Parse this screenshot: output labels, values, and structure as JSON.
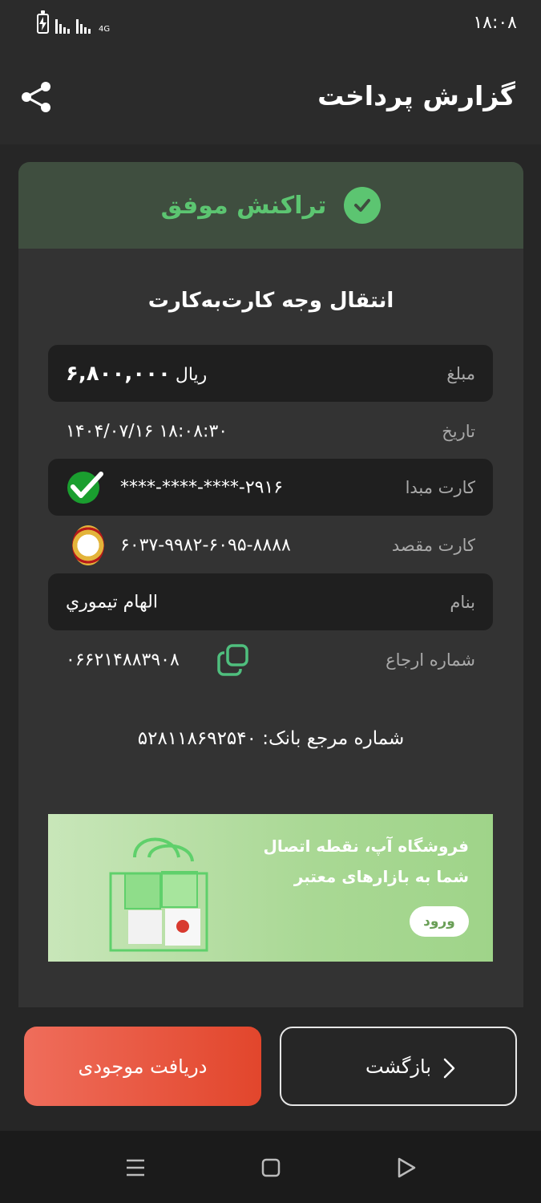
{
  "status_bar": {
    "time": "۱۸:۰۸",
    "network": "4G"
  },
  "appbar": {
    "title": "گزارش پرداخت",
    "share_icon": "share-icon"
  },
  "receipt": {
    "status_text": "تراکنش موفق",
    "status_color": "#5cc571",
    "transaction_title": "انتقال وجه کارت‌به‌کارت",
    "rows": {
      "amount": {
        "label": "مبلغ",
        "value": "۶,۸۰۰,۰۰۰",
        "unit": "ریال"
      },
      "date": {
        "label": "تاریخ",
        "value": "۱۴۰۴/۰۷/۱۶  ۱۸:۰۸:۳۰"
      },
      "source_card": {
        "label": "کارت مبدا",
        "value": "****-****-****-۲۹۱۶"
      },
      "dest_card": {
        "label": "کارت مقصد",
        "value": "۶۰۳۷-۹۹۸۲-۶۰۹۵-۸۸۸۸"
      },
      "name": {
        "label": "بنام",
        "value": "الهام تیموري"
      },
      "reference": {
        "label": "شماره ارجاع",
        "value": "۰۶۶۲۱۴۸۸۳۹۰۸"
      }
    },
    "bank_reference": "شماره مرجع بانک: ۵۲۸۱۱۸۶۹۲۵۴۰"
  },
  "banner": {
    "line1": "فروشگاه آپ، نقطه اتصال",
    "line2": "شما به بازارهای معتبر",
    "button_label": "ورود"
  },
  "actions": {
    "balance_label": "دریافت موجودی",
    "back_label": "بازگشت"
  }
}
